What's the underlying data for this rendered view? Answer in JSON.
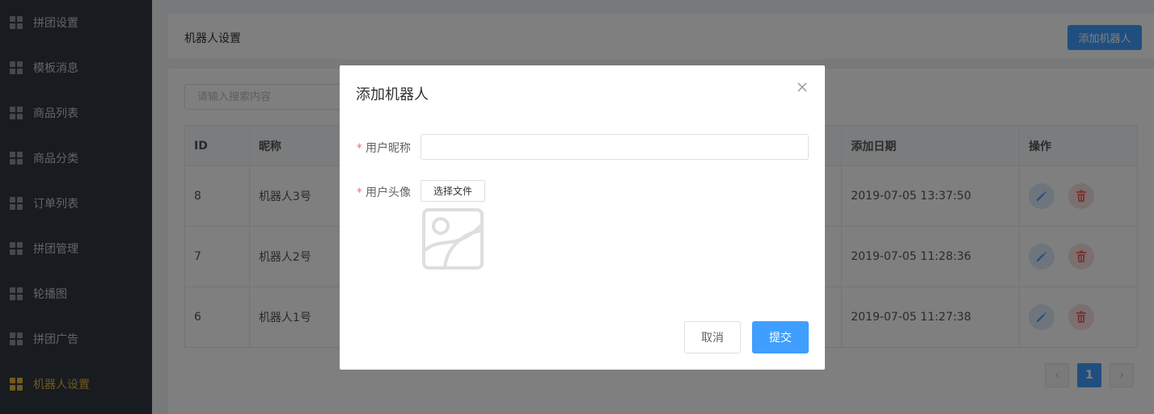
{
  "sidebar": {
    "items": [
      {
        "label": "拼团设置",
        "active": false
      },
      {
        "label": "模板消息",
        "active": false
      },
      {
        "label": "商品列表",
        "active": false
      },
      {
        "label": "商品分类",
        "active": false
      },
      {
        "label": "订单列表",
        "active": false
      },
      {
        "label": "拼团管理",
        "active": false
      },
      {
        "label": "轮播图",
        "active": false
      },
      {
        "label": "拼团广告",
        "active": false
      },
      {
        "label": "机器人设置",
        "active": true
      }
    ]
  },
  "header": {
    "title": "机器人设置",
    "add_button_label": "添加机器人"
  },
  "search": {
    "placeholder": "请输入搜索内容"
  },
  "table": {
    "columns": [
      "ID",
      "昵称",
      "添加日期",
      "操作"
    ],
    "rows": [
      {
        "id": "8",
        "nickname": "机器人3号",
        "date": "2019-07-05 13:37:50"
      },
      {
        "id": "7",
        "nickname": "机器人2号",
        "date": "2019-07-05 11:28:36"
      },
      {
        "id": "6",
        "nickname": "机器人1号",
        "date": "2019-07-05 11:27:38"
      }
    ],
    "row_action_icons": [
      "pencil-icon",
      "trash-icon"
    ]
  },
  "pagination": {
    "current_page": "1",
    "prev_icon": "chevron-left-icon",
    "next_icon": "chevron-right-icon"
  },
  "modal": {
    "title": "添加机器人",
    "required_mark": "*",
    "nickname_label": "用户昵称",
    "nickname_value": "",
    "avatar_label": "用户头像",
    "choose_file_label": "选择文件",
    "cancel_label": "取消",
    "submit_label": "提交",
    "close_icon": "close-icon",
    "avatar_placeholder_icon": "image-placeholder-icon"
  },
  "colors": {
    "sidebar_bg": "#313740",
    "sidebar_active": "#e6b23a",
    "primary": "#409eff",
    "danger": "#f56c6c"
  }
}
